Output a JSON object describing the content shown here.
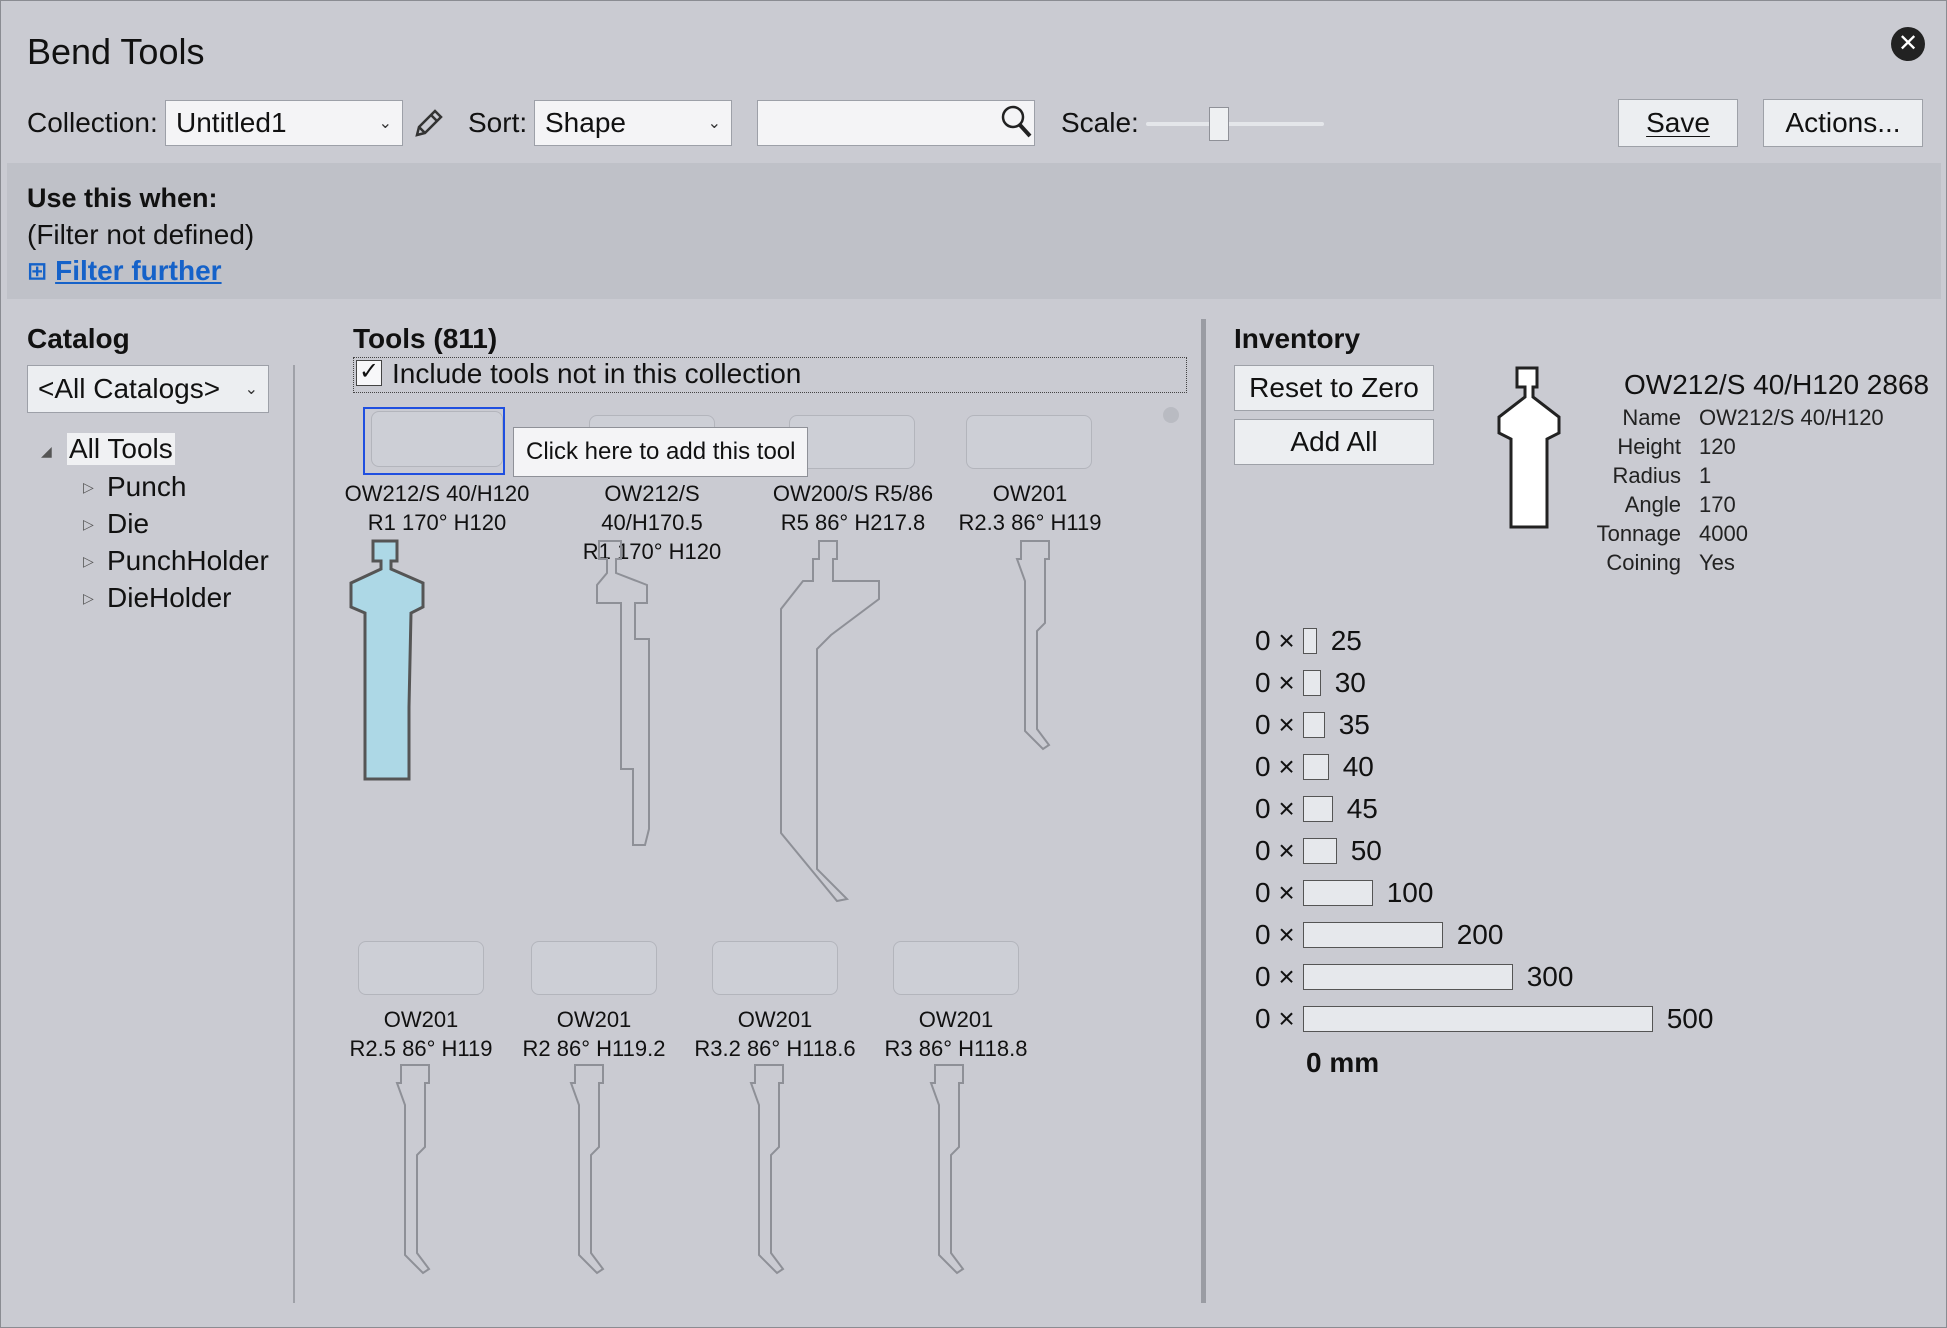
{
  "window": {
    "title": "Bend Tools"
  },
  "toolbar": {
    "collection_label": "Collection:",
    "collection_value": "Untitled1",
    "sort_label": "Sort:",
    "sort_value": "Shape",
    "search_value": "",
    "scale_label": "Scale:",
    "scale_fraction": 0.4,
    "save_label": "Save",
    "actions_label": "Actions..."
  },
  "use_this": {
    "heading": "Use this when:",
    "filter_text": "(Filter not defined)",
    "filter_link": "Filter further",
    "filter_icon": "⊞"
  },
  "catalog": {
    "heading": "Catalog",
    "dropdown": "<All Catalogs>",
    "tree": {
      "root": "All Tools",
      "children": [
        "Punch",
        "Die",
        "PunchHolder",
        "DieHolder"
      ]
    }
  },
  "tools": {
    "heading": "Tools (811)",
    "include_label": "Include tools not in this collection",
    "include_checked": true,
    "tooltip": "Click here to add this tool",
    "items": [
      {
        "name": "OW212/S 40/H120",
        "spec": "R1  170°  H120",
        "selected": true
      },
      {
        "name": "OW212/S 40/H170.5",
        "spec": "R1  170°  H120"
      },
      {
        "name": "OW200/S R5/86",
        "spec": "R5  86°  H217.8"
      },
      {
        "name": "OW201",
        "spec": "R2.3  86°  H119"
      },
      {
        "name": "OW201",
        "spec": "R2.5  86°  H119"
      },
      {
        "name": "OW201",
        "spec": "R2  86°  H119.2"
      },
      {
        "name": "OW201",
        "spec": "R3.2  86°  H118.6"
      },
      {
        "name": "OW201",
        "spec": "R3  86°  H118.8"
      }
    ]
  },
  "inventory": {
    "heading": "Inventory",
    "reset_label": "Reset to Zero",
    "add_all_label": "Add All",
    "detail_title": "OW212/S 40/H120 2868",
    "props": [
      {
        "k": "Name",
        "v": "OW212/S 40/H120"
      },
      {
        "k": "Height",
        "v": "120"
      },
      {
        "k": "Radius",
        "v": "1"
      },
      {
        "k": "Angle",
        "v": "170"
      },
      {
        "k": "Tonnage",
        "v": "4000"
      },
      {
        "k": "Coining",
        "v": "Yes"
      }
    ],
    "rows": [
      {
        "count": "0 ×",
        "len": "25"
      },
      {
        "count": "0 ×",
        "len": "30"
      },
      {
        "count": "0 ×",
        "len": "35"
      },
      {
        "count": "0 ×",
        "len": "40"
      },
      {
        "count": "0 ×",
        "len": "45"
      },
      {
        "count": "0 ×",
        "len": "50"
      },
      {
        "count": "0 ×",
        "len": "100"
      },
      {
        "count": "0 ×",
        "len": "200"
      },
      {
        "count": "0 ×",
        "len": "300"
      },
      {
        "count": "0 ×",
        "len": "500"
      }
    ],
    "total": "0 mm"
  }
}
